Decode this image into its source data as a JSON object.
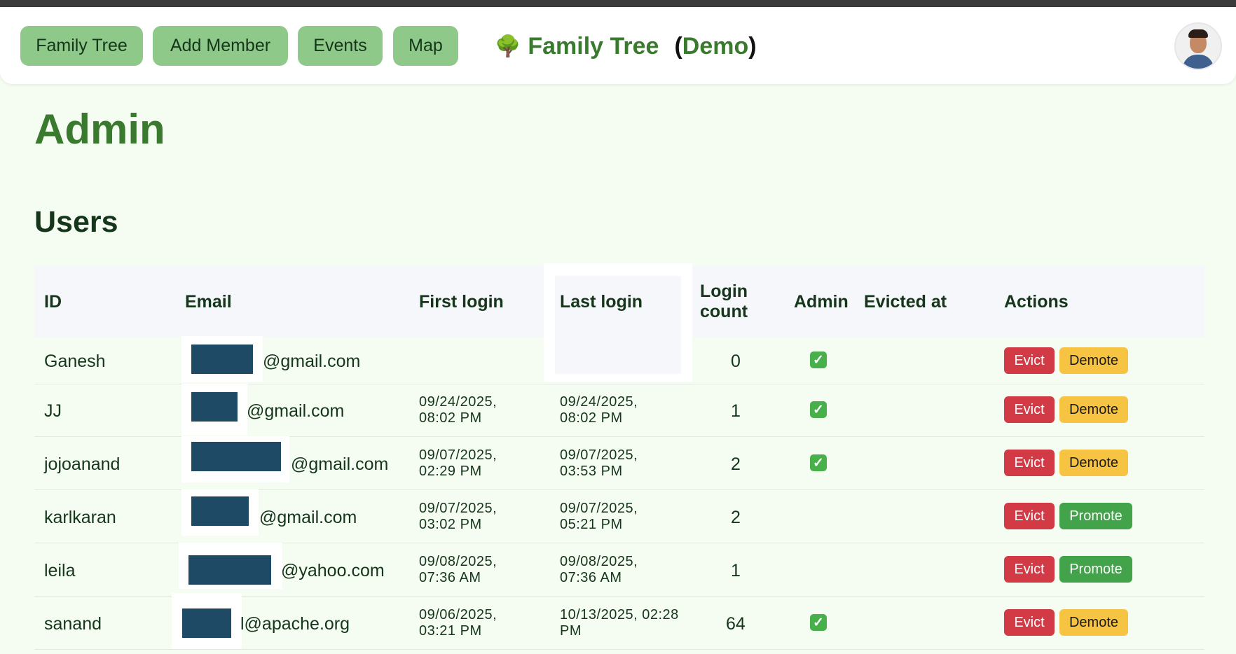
{
  "nav": {
    "buttons": [
      "Family Tree",
      "Add Member",
      "Events",
      "Map"
    ],
    "brand_icon": "🌳",
    "brand_title": "Family Tree",
    "brand_demo_open": "(",
    "brand_demo": "Demo",
    "brand_demo_close": ")",
    "avatar_icon": "user-avatar"
  },
  "page": {
    "title": "Admin",
    "section": "Users"
  },
  "table": {
    "headers": {
      "id": "ID",
      "email": "Email",
      "first_login": "First login",
      "last_login": "Last login",
      "login_count": "Login count",
      "admin": "Admin",
      "evicted_at": "Evicted at",
      "actions": "Actions"
    },
    "rows": [
      {
        "id": "Ganesh",
        "email": "@gmail.com",
        "first_login": "",
        "last_login": "",
        "login_count": "0",
        "admin": true,
        "evicted_at": "",
        "evict": "Evict",
        "role_action": "Demote"
      },
      {
        "id": "JJ",
        "email": "@gmail.com",
        "first_login": "09/24/2025, 08:02 PM",
        "first_login_l1": "09/24/2025,",
        "first_login_l2": "08:02 PM",
        "last_login_l1": "09/24/2025,",
        "last_login_l2": "08:02 PM",
        "login_count": "1",
        "admin": true,
        "evicted_at": "",
        "evict": "Evict",
        "role_action": "Demote"
      },
      {
        "id": "jojoanand",
        "email": "@gmail.com",
        "first_login_l1": "09/07/2025,",
        "first_login_l2": "02:29 PM",
        "last_login_l1": "09/07/2025,",
        "last_login_l2": "03:53 PM",
        "login_count": "2",
        "admin": true,
        "evicted_at": "",
        "evict": "Evict",
        "role_action": "Demote"
      },
      {
        "id": "karlkaran",
        "email": "@gmail.com",
        "first_login_l1": "09/07/2025,",
        "first_login_l2": "03:02 PM",
        "last_login_l1": "09/07/2025,",
        "last_login_l2": "05:21 PM",
        "login_count": "2",
        "admin": false,
        "evicted_at": "",
        "evict": "Evict",
        "role_action": "Promote"
      },
      {
        "id": "leila",
        "email": "@yahoo.com",
        "first_login_l1": "09/08/2025,",
        "first_login_l2": "07:36 AM",
        "last_login_l1": "09/08/2025,",
        "last_login_l2": "07:36 AM",
        "login_count": "1",
        "admin": false,
        "evicted_at": "",
        "evict": "Evict",
        "role_action": "Promote"
      },
      {
        "id": "sanand",
        "email": "l@apache.org",
        "first_login_l1": "09/06/2025,",
        "first_login_l2": "03:21 PM",
        "last_login_l1": "10/13/2025, 02:28",
        "last_login_l2": "PM",
        "login_count": "64",
        "admin": true,
        "evicted_at": "",
        "evict": "Evict",
        "role_action": "Demote"
      }
    ],
    "admin_check_glyph": "✓"
  },
  "colors": {
    "accent_green": "#3a7a2e",
    "nav_button": "#8fc98a",
    "evict": "#d23a45",
    "demote": "#f6c343",
    "promote": "#43a34a",
    "redaction": "#1e4a66"
  }
}
